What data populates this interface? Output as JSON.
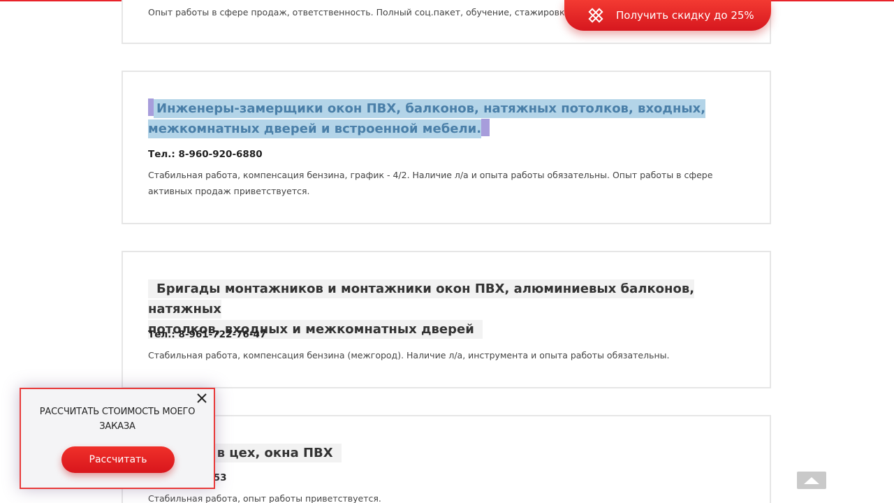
{
  "discount_button": {
    "label": "Получить скидку до 25%",
    "icon": "ruler-pencil-icon"
  },
  "jobs": [
    {
      "description": "Опыт работы в сфере продаж, ответственность. Полный соц.пакет, обучение, стажировка.Г"
    },
    {
      "title_line1": "Инженеры-замерщики окон ПВХ, балконов, натяжных потолков, входных,",
      "title_line2": "межкомнатных дверей и встроенной мебели.",
      "phone": "Тел.: 8-960-920-6880",
      "description_line1": "Стабильная работа, компенсация бензина, график - 4/2. Наличие л/а и опыта работы обязательны. Опыт работы в сфере",
      "description_line2": "активных продаж приветствуется."
    },
    {
      "title_line1": "Бригады монтажников и монтажники окон ПВХ, алюминиевых балконов, натяжных",
      "title_line2": "потолков, входных и межкомнатных дверей",
      "phone": "Тел.: 8-961-722-76-47",
      "description": "Стабильная работа, компенсация бензина (межгород). Наличие л/а, инструмента и опыта работы обязательны."
    },
    {
      "title_visible": "о в цех, окна ПВХ",
      "phone_visible": "2-7653",
      "description": "Стабильная работа, опыт работы приветствуется."
    }
  ],
  "calc_popup": {
    "text_line1": "РАССЧИТАТЬ СТОИМОСТЬ МОЕГО",
    "text_line2": "ЗАКАЗА",
    "button_label": "Рассчитать",
    "close_icon": "close-icon"
  },
  "scroll_top": {
    "icon": "triangle-up-icon"
  },
  "colors": {
    "accent": "#e8232a",
    "selection": "#b3d4e8",
    "selection_edge": "#a79ddb",
    "card_border": "#e6e6e6"
  }
}
